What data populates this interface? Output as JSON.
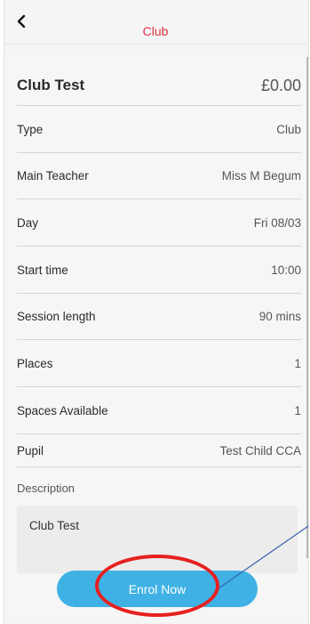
{
  "header": {
    "back_icon": "chevron-left-icon",
    "title": "Club"
  },
  "club": {
    "name": "Club Test",
    "price": "£0.00"
  },
  "details": [
    {
      "label": "Type",
      "value": "Club"
    },
    {
      "label": "Main Teacher",
      "value": "Miss M Begum"
    },
    {
      "label": "Day",
      "value": "Fri 08/03"
    },
    {
      "label": "Start time",
      "value": "10:00"
    },
    {
      "label": "Session length",
      "value": "90 mins"
    },
    {
      "label": "Places",
      "value": "1"
    },
    {
      "label": "Spaces Available",
      "value": "1"
    },
    {
      "label": "Pupil",
      "value": "Test Child CCA"
    }
  ],
  "description": {
    "label": "Description",
    "text": "Club Test"
  },
  "actions": {
    "enrol_label": "Enrol Now"
  },
  "colors": {
    "accent": "#e0323f",
    "button": "#3fb1e4",
    "highlight": "#e6201f",
    "pointer": "#3a5fb0"
  }
}
